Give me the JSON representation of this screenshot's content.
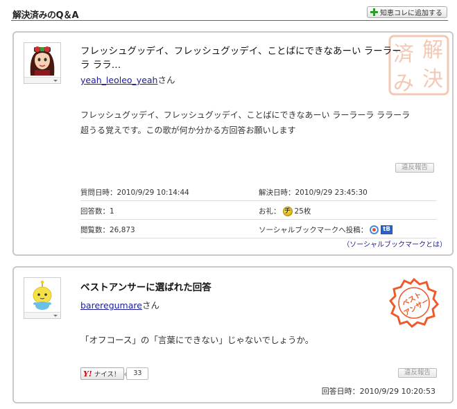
{
  "header": {
    "title": "解決済みのQ＆A",
    "add_button_label": "知恵コレに追加する"
  },
  "question": {
    "title": "フレッシュグッデイ、フレッシュグッデイ、ことばにできなあーい ラーラーラ ララ…",
    "user_name": "yeah_leoleo_yeah",
    "user_suffix": "さん",
    "body_lines": [
      "フレッシュグッデイ、フレッシュグッデイ、ことばにできなあーい ラーラーラ ララーラ",
      "超うる覚えです。この歌が何か分かる方回答お願いします"
    ],
    "report_label": "違反報告",
    "meta": {
      "asked_label": "質問日時：2010/9/29 10:14:44",
      "resolved_label": "解決日時：2010/9/29 23:45:30",
      "answers_label": "回答数：1",
      "reward_label": "お礼：",
      "reward_coin": "チ",
      "reward_value": "25枚",
      "views_label": "閲覧数：26,873",
      "social_label": "ソーシャルブックマークへ投稿：",
      "hatena_label": "B"
    },
    "social_link": "（ソーシャルブックマークとは）",
    "seal_text": [
      "解",
      "決",
      "済",
      "み"
    ]
  },
  "answer": {
    "title": "ベストアンサーに選ばれた回答",
    "user_name": "bareregumare",
    "user_suffix": "さん",
    "body": "「オフコース」の「言葉にできない」じゃないでしょうか。",
    "nice_icon": "Y!",
    "nice_label": "ナイス！",
    "nice_count": "33",
    "report_label": "違反報告",
    "date": "回答日時：2010/9/29 10:20:53",
    "seal_text": [
      "ベスト",
      "アンサー"
    ]
  },
  "colors": {
    "seal_resolved": "#f3c9b6",
    "seal_best": "#ee5a2a",
    "link": "#1a1a9a",
    "plus_icon": "#2e9a2e"
  }
}
